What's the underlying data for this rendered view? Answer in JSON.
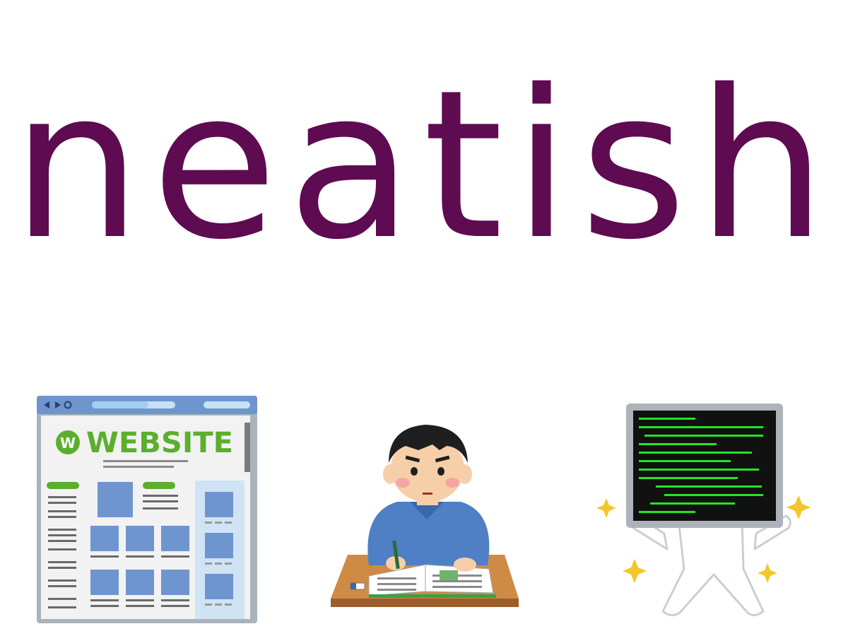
{
  "word": "neatish",
  "colors": {
    "word": "#5e0b52",
    "website_green": "#5cae2e",
    "website_blue": "#6f95cf",
    "terminal_green": "#26e226"
  },
  "illustrations": {
    "website": {
      "logo_letter": "W",
      "logo_text": "WEBSITE",
      "icon": "website-browser-icon"
    },
    "student": {
      "icon": "student-studying-icon"
    },
    "computer": {
      "icon": "computer-character-icon"
    }
  }
}
